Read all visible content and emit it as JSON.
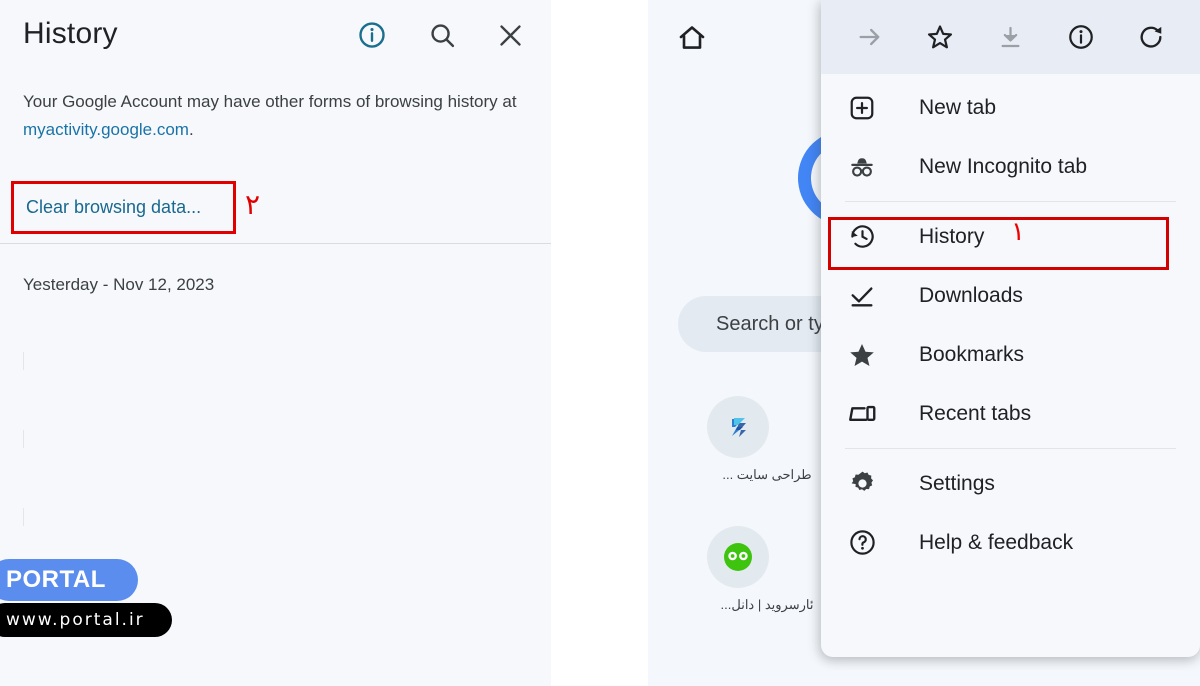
{
  "left_panel": {
    "title": "History",
    "header_icons": [
      {
        "name": "info-icon",
        "glyph": "info"
      },
      {
        "name": "search-icon",
        "glyph": "search"
      },
      {
        "name": "close-icon",
        "glyph": "close"
      }
    ],
    "note_before": "Your Google Account may have other forms of browsing history at ",
    "note_link": "myactivity.google.com",
    "note_after": ".",
    "clear_link": "Clear browsing data...",
    "step_marker": "۲",
    "date_group": "Yesterday - Nov 12, 2023"
  },
  "watermark": {
    "brand": "PORTAL",
    "url": "www.portal.ir"
  },
  "right_panel": {
    "home_icon": "home-icon",
    "search_placeholder": "Search or typ",
    "tiles": [
      {
        "label": "طراحی سایت ...",
        "ellipsis": "..."
      },
      {
        "label": "ئارسروید | دانل...",
        "ellipsis": ".."
      }
    ],
    "menu": {
      "toolbar": [
        {
          "name": "forward-icon",
          "label": "Forward",
          "disabled": true
        },
        {
          "name": "star-icon",
          "label": "Bookmark",
          "disabled": false
        },
        {
          "name": "download-icon",
          "label": "Download",
          "disabled": true
        },
        {
          "name": "page-info-icon",
          "label": "Page info",
          "disabled": false
        },
        {
          "name": "reload-icon",
          "label": "Reload",
          "disabled": false
        }
      ],
      "items": [
        {
          "label": "New tab",
          "icon": "new-tab-icon"
        },
        {
          "label": "New Incognito tab",
          "icon": "incognito-icon"
        },
        {
          "label": "History",
          "icon": "history-icon",
          "highlighted": true,
          "marker": "۱"
        },
        {
          "label": "Downloads",
          "icon": "downloads-icon"
        },
        {
          "label": "Bookmarks",
          "icon": "bookmarks-icon"
        },
        {
          "label": "Recent tabs",
          "icon": "recent-tabs-icon"
        },
        {
          "label": "Settings",
          "icon": "settings-gear-icon"
        },
        {
          "label": "Help & feedback",
          "icon": "help-icon"
        }
      ]
    }
  },
  "colors": {
    "panel_bg": "#f6f8fc",
    "menu_toolbar_bg": "#e8edf5",
    "link": "#18688f",
    "highlight_red": "#d30000",
    "marker_red": "#ef0000",
    "google_blue": "#4285f4",
    "watermark_blue": "#5b8def"
  }
}
